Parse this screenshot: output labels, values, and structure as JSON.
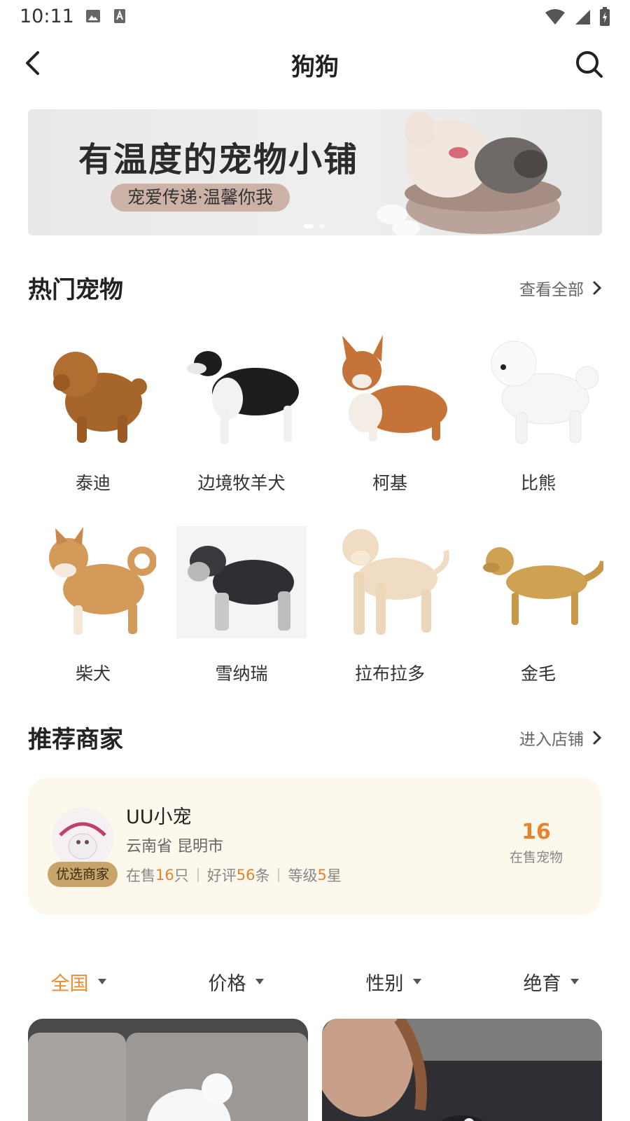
{
  "status": {
    "time": "10:11"
  },
  "header": {
    "title": "狗狗"
  },
  "banner": {
    "title": "有温度的宠物小铺",
    "subtitle": "宠爱传递·温馨你我"
  },
  "hot_pets": {
    "title": "热门宠物",
    "link": "查看全部",
    "items": [
      {
        "name": "泰迪"
      },
      {
        "name": "边境牧羊犬"
      },
      {
        "name": "柯基"
      },
      {
        "name": "比熊"
      },
      {
        "name": "柴犬"
      },
      {
        "name": "雪纳瑞"
      },
      {
        "name": "拉布拉多"
      },
      {
        "name": "金毛"
      }
    ]
  },
  "recommended": {
    "title": "推荐商家",
    "link": "进入店铺",
    "merchant": {
      "name": "UU小宠",
      "location": "云南省 昆明市",
      "badge": "优选商家",
      "logo_text": "CATTYLLO PET",
      "stats": {
        "on_sale_prefix": "在售 ",
        "on_sale_count": "16",
        "on_sale_unit": "只",
        "review_prefix": "好评",
        "review_count": "56",
        "review_unit": "条",
        "level_prefix": "等级",
        "level_value": "5",
        "level_unit": "星"
      },
      "count": "16",
      "count_label": "在售宠物"
    }
  },
  "filters": [
    {
      "label": "全国",
      "active": true
    },
    {
      "label": "价格",
      "active": false
    },
    {
      "label": "性别",
      "active": false
    },
    {
      "label": "绝育",
      "active": false
    }
  ],
  "colors": {
    "accent": "#ef8a2e",
    "card_bg": "#fdf8ec",
    "badge": "#c8a46a"
  }
}
